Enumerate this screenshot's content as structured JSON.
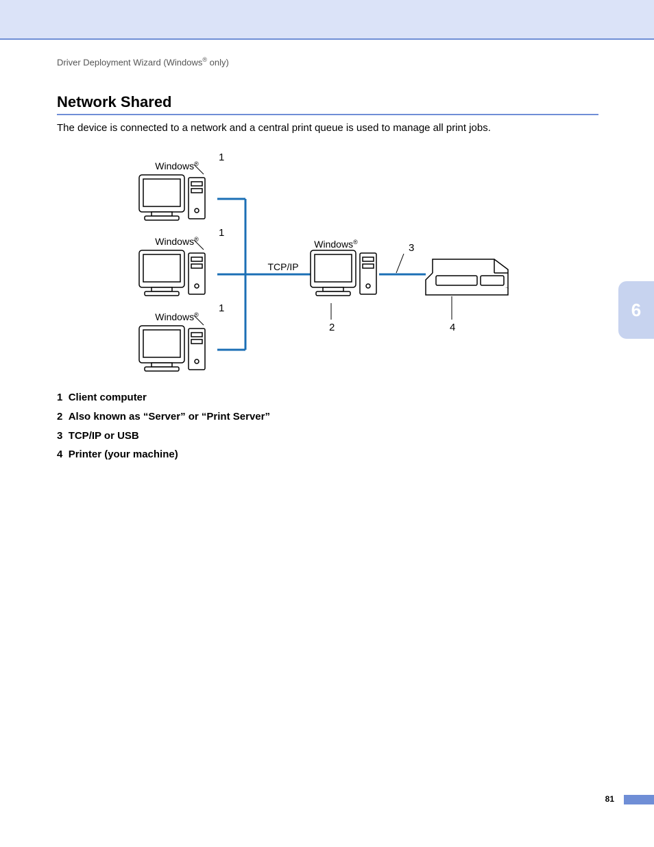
{
  "breadcrumb": {
    "prefix": "Driver Deployment Wizard (Windows",
    "suffix": " only)",
    "reg": "®"
  },
  "heading": "Network Shared",
  "intro": "The device is connected to a network and a central print queue is used to manage all print jobs.",
  "chapter_tab": "6",
  "page_number": "81",
  "diagram": {
    "windows_label": "Windows",
    "reg": "®",
    "tcpip_label": "TCP/IP",
    "callouts": {
      "c1": "1",
      "c2": "2",
      "c3": "3",
      "c4": "4"
    }
  },
  "legend": [
    {
      "num": "1",
      "text": "Client computer"
    },
    {
      "num": "2",
      "text": "Also known as “Server” or “Print Server”"
    },
    {
      "num": "3",
      "text": "TCP/IP or USB"
    },
    {
      "num": "4",
      "text": "Printer (your machine)"
    }
  ]
}
